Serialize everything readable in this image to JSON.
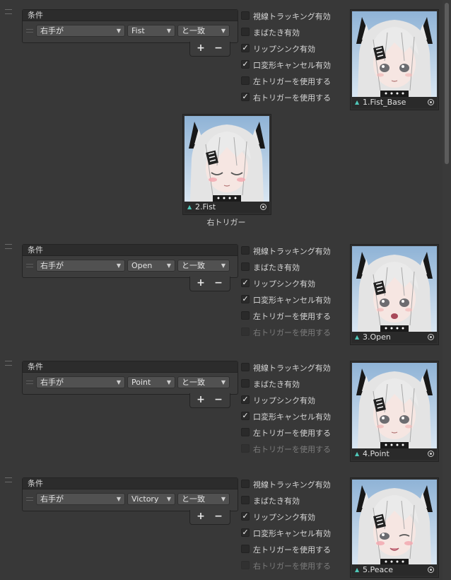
{
  "colors": {
    "background": "#383838",
    "accent_triangle": "#4fc7b8",
    "checkbox_bg": "#2a2a2a"
  },
  "icons": {
    "handle": "drag-handle-icon",
    "dropdown": "chevron-down-icon",
    "check": "checkmark-icon",
    "asset": "asset-triangle-icon",
    "picker": "object-picker-icon"
  },
  "gestures": [
    {
      "condition_title": "条件",
      "hand": "右手が",
      "gesture": "Fist",
      "operator": "と一致",
      "plus": "+",
      "minus": "−",
      "toggles": [
        {
          "label": "視線トラッキング有効",
          "checked": false,
          "check": "",
          "disabled": false
        },
        {
          "label": "まばたき有効",
          "checked": false,
          "check": "",
          "disabled": false
        },
        {
          "label": "リップシンク有効",
          "checked": true,
          "check": "✓",
          "disabled": false
        },
        {
          "label": "口変形キャンセル有効",
          "checked": true,
          "check": "✓",
          "disabled": false
        },
        {
          "label": "左トリガーを使用する",
          "checked": false,
          "check": "",
          "disabled": false
        },
        {
          "label": "右トリガーを使用する",
          "checked": true,
          "check": "✓",
          "disabled": false
        }
      ],
      "thumbnail": {
        "name": "1.Fist_Base",
        "eyes": "open",
        "mouth": "closed"
      },
      "trigger_thumbnail": {
        "name": "2.Fist",
        "eyes": "closed",
        "mouth": "closed"
      },
      "trigger_label": "右トリガー"
    },
    {
      "condition_title": "条件",
      "hand": "右手が",
      "gesture": "Open",
      "operator": "と一致",
      "plus": "+",
      "minus": "−",
      "toggles": [
        {
          "label": "視線トラッキング有効",
          "checked": false,
          "check": "",
          "disabled": false
        },
        {
          "label": "まばたき有効",
          "checked": false,
          "check": "",
          "disabled": false
        },
        {
          "label": "リップシンク有効",
          "checked": true,
          "check": "✓",
          "disabled": false
        },
        {
          "label": "口変形キャンセル有効",
          "checked": true,
          "check": "✓",
          "disabled": false
        },
        {
          "label": "左トリガーを使用する",
          "checked": false,
          "check": "",
          "disabled": false
        },
        {
          "label": "右トリガーを使用する",
          "checked": false,
          "check": "",
          "disabled": true
        }
      ],
      "thumbnail": {
        "name": "3.Open",
        "eyes": "open",
        "mouth": "open"
      }
    },
    {
      "condition_title": "条件",
      "hand": "右手が",
      "gesture": "Point",
      "operator": "と一致",
      "plus": "+",
      "minus": "−",
      "toggles": [
        {
          "label": "視線トラッキング有効",
          "checked": false,
          "check": "",
          "disabled": false
        },
        {
          "label": "まばたき有効",
          "checked": false,
          "check": "",
          "disabled": false
        },
        {
          "label": "リップシンク有効",
          "checked": true,
          "check": "✓",
          "disabled": false
        },
        {
          "label": "口変形キャンセル有効",
          "checked": true,
          "check": "✓",
          "disabled": false
        },
        {
          "label": "左トリガーを使用する",
          "checked": false,
          "check": "",
          "disabled": false
        },
        {
          "label": "右トリガーを使用する",
          "checked": false,
          "check": "",
          "disabled": true
        }
      ],
      "thumbnail": {
        "name": "4.Point",
        "eyes": "open",
        "mouth": "closed"
      }
    },
    {
      "condition_title": "条件",
      "hand": "右手が",
      "gesture": "Victory",
      "operator": "と一致",
      "plus": "+",
      "minus": "−",
      "toggles": [
        {
          "label": "視線トラッキング有効",
          "checked": false,
          "check": "",
          "disabled": false
        },
        {
          "label": "まばたき有効",
          "checked": false,
          "check": "",
          "disabled": false
        },
        {
          "label": "リップシンク有効",
          "checked": true,
          "check": "✓",
          "disabled": false
        },
        {
          "label": "口変形キャンセル有効",
          "checked": true,
          "check": "✓",
          "disabled": false
        },
        {
          "label": "左トリガーを使用する",
          "checked": false,
          "check": "",
          "disabled": false
        },
        {
          "label": "右トリガーを使用する",
          "checked": false,
          "check": "",
          "disabled": true
        }
      ],
      "thumbnail": {
        "name": "5.Peace",
        "eyes": "open",
        "mouth": "smile"
      }
    }
  ]
}
